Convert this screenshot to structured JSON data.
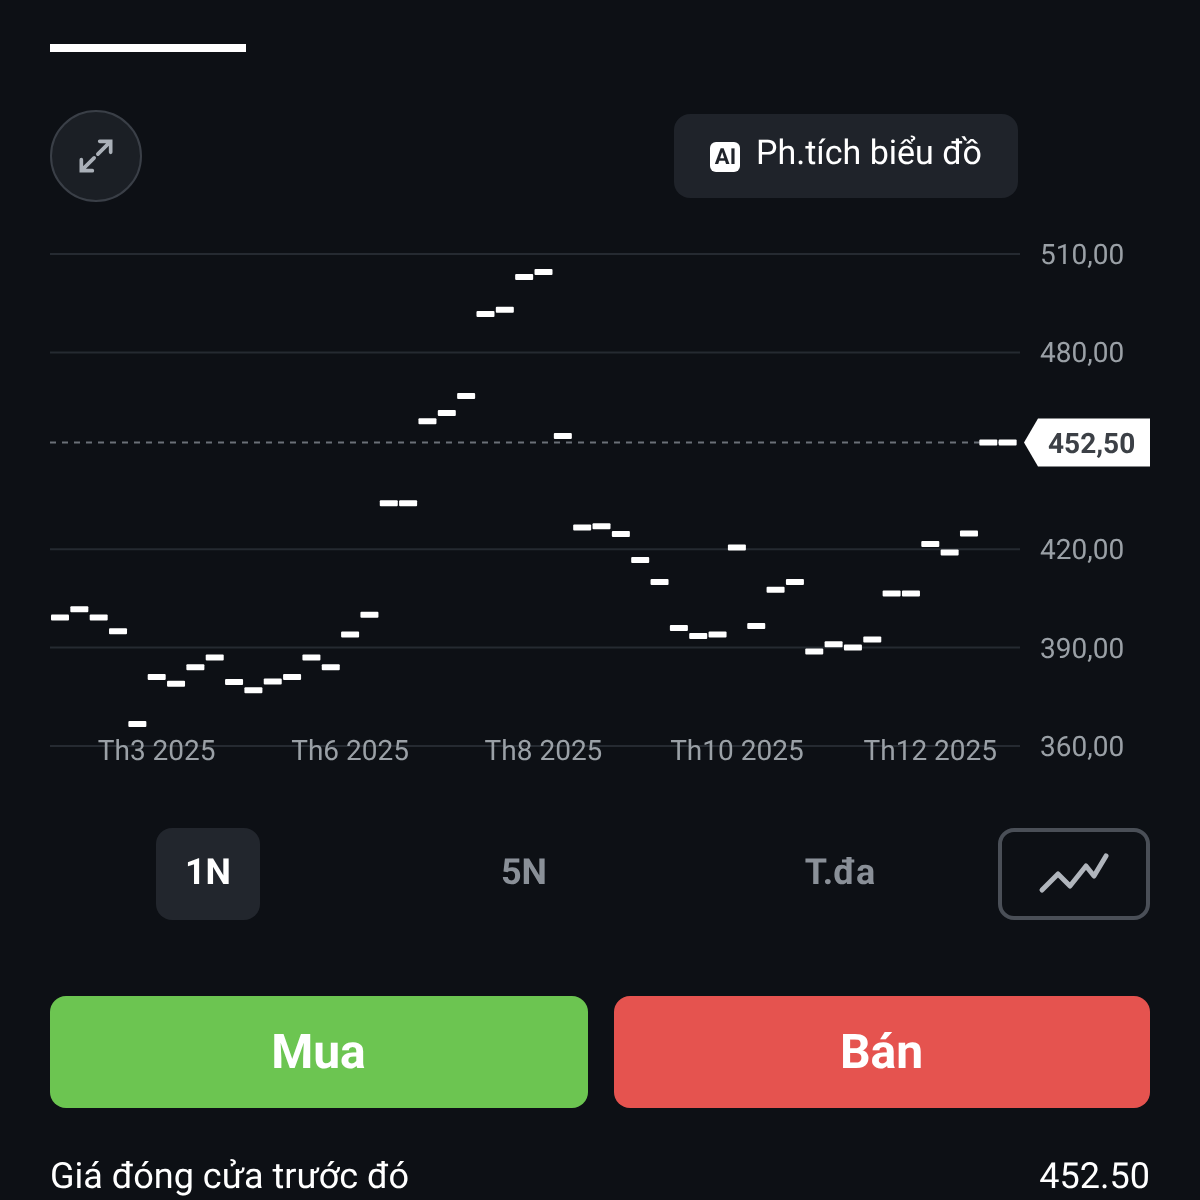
{
  "tab_indicator": {
    "selected": true
  },
  "ai_button": {
    "badge": "AI",
    "label": "Ph.tích biểu đồ"
  },
  "chart": {
    "current_price_label": "452,50",
    "chart_data": {
      "type": "scatter",
      "categories": [
        null,
        null,
        null,
        null,
        null,
        "Th3 2025",
        null,
        null,
        null,
        null,
        null,
        null,
        null,
        null,
        null,
        "Th6 2025",
        null,
        null,
        null,
        null,
        null,
        null,
        null,
        null,
        null,
        "Th8 2025",
        null,
        null,
        null,
        null,
        null,
        null,
        null,
        null,
        null,
        "Th10 2025",
        null,
        null,
        null,
        null,
        null,
        null,
        null,
        null,
        null,
        "Th12 2025",
        null,
        null,
        null,
        null
      ],
      "series": [
        {
          "color": "#ffffff",
          "values": [
            399.2,
            401.7,
            399.2,
            395,
            366.7,
            381,
            379,
            384,
            387,
            379.5,
            377,
            379.7,
            381,
            387,
            384,
            394,
            400,
            434,
            434,
            459,
            461.5,
            466.7,
            491.7,
            493,
            503,
            504.5,
            454.5,
            426.6,
            427,
            424.6,
            416.7,
            410,
            396,
            393.5,
            394,
            420.5,
            396.6,
            407.6,
            410,
            388.8,
            391,
            390,
            392.5,
            406.5,
            406.5,
            421.6,
            419,
            424.8,
            452.5,
            452.5
          ]
        }
      ],
      "grid": true,
      "ref_lines": [
        {
          "axis": "y",
          "value": 452.5
        }
      ],
      "ylim": [
        360,
        510
      ],
      "yticks": [
        {
          "value": 510,
          "label": "510,00"
        },
        {
          "value": 480,
          "label": "480,00"
        },
        {
          "value": 420,
          "label": "420,00"
        },
        {
          "value": 390,
          "label": "390,00"
        },
        {
          "value": 360,
          "label": "360,00"
        }
      ]
    }
  },
  "periods": [
    {
      "label": "1N",
      "selected": true
    },
    {
      "label": "5N",
      "selected": false
    },
    {
      "label": "T.đa",
      "selected": false
    }
  ],
  "actions": [
    {
      "kind": "buy",
      "label": "Mua"
    },
    {
      "kind": "sell",
      "label": "Bán"
    }
  ],
  "stats": [
    {
      "label": "Giá đóng cửa trước đó",
      "value": "452.50"
    }
  ]
}
